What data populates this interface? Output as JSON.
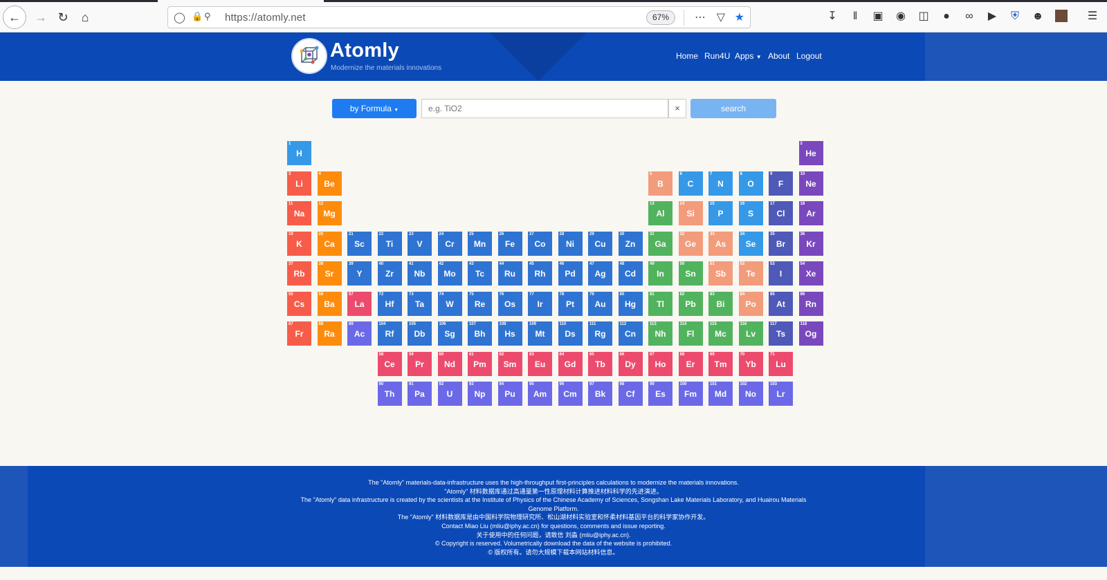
{
  "browser": {
    "url": "https://atomly.net",
    "zoom": "67%",
    "icons": [
      "back-icon",
      "forward-icon",
      "reload-icon",
      "home-icon",
      "shield-icon",
      "lock-icon",
      "key-icon",
      "more-icon",
      "pocket-icon",
      "star-icon",
      "download-icon",
      "library-icon",
      "containers-icon",
      "circle-icon",
      "sidebar-icon",
      "extension-icon",
      "link-icon",
      "arrow-icon",
      "ublock-icon",
      "account-icon",
      "avatar-icon",
      "menu-icon"
    ]
  },
  "header": {
    "title": "Atomly",
    "subtitle": "Modernize the materials innovations",
    "menu": [
      "Home",
      "Run4U",
      "Apps",
      "About",
      "Logout"
    ]
  },
  "search": {
    "mode_label": "by Formula",
    "placeholder": "e.g. TiO2",
    "clear_label": "×",
    "button_label": "search"
  },
  "colors": {
    "alkali": "#f75c4a",
    "alkaline": "#fd8c0d",
    "transition": "#2f74d2",
    "lanthanide": "#ec4b6e",
    "actinide": "#6b69e8",
    "post_transition": "#52b35f",
    "metalloid": "#f29c7c",
    "nonmetal": "#3699e8",
    "halogen": "#4e59b8",
    "noble": "#7a48bd"
  },
  "elements": [
    {
      "n": "1",
      "s": "H",
      "r": 1,
      "c": 1,
      "t": "nonmetal"
    },
    {
      "n": "2",
      "s": "He",
      "r": 1,
      "c": 18,
      "t": "noble"
    },
    {
      "n": "3",
      "s": "Li",
      "r": 2,
      "c": 1,
      "t": "alkali"
    },
    {
      "n": "4",
      "s": "Be",
      "r": 2,
      "c": 2,
      "t": "alkaline"
    },
    {
      "n": "5",
      "s": "B",
      "r": 2,
      "c": 13,
      "t": "metalloid"
    },
    {
      "n": "6",
      "s": "C",
      "r": 2,
      "c": 14,
      "t": "nonmetal"
    },
    {
      "n": "7",
      "s": "N",
      "r": 2,
      "c": 15,
      "t": "nonmetal"
    },
    {
      "n": "8",
      "s": "O",
      "r": 2,
      "c": 16,
      "t": "nonmetal"
    },
    {
      "n": "9",
      "s": "F",
      "r": 2,
      "c": 17,
      "t": "halogen"
    },
    {
      "n": "10",
      "s": "Ne",
      "r": 2,
      "c": 18,
      "t": "noble"
    },
    {
      "n": "11",
      "s": "Na",
      "r": 3,
      "c": 1,
      "t": "alkali"
    },
    {
      "n": "12",
      "s": "Mg",
      "r": 3,
      "c": 2,
      "t": "alkaline"
    },
    {
      "n": "13",
      "s": "Al",
      "r": 3,
      "c": 13,
      "t": "post_transition"
    },
    {
      "n": "14",
      "s": "Si",
      "r": 3,
      "c": 14,
      "t": "metalloid"
    },
    {
      "n": "15",
      "s": "P",
      "r": 3,
      "c": 15,
      "t": "nonmetal"
    },
    {
      "n": "16",
      "s": "S",
      "r": 3,
      "c": 16,
      "t": "nonmetal"
    },
    {
      "n": "17",
      "s": "Cl",
      "r": 3,
      "c": 17,
      "t": "halogen"
    },
    {
      "n": "18",
      "s": "Ar",
      "r": 3,
      "c": 18,
      "t": "noble"
    },
    {
      "n": "19",
      "s": "K",
      "r": 4,
      "c": 1,
      "t": "alkali"
    },
    {
      "n": "20",
      "s": "Ca",
      "r": 4,
      "c": 2,
      "t": "alkaline"
    },
    {
      "n": "21",
      "s": "Sc",
      "r": 4,
      "c": 3,
      "t": "transition"
    },
    {
      "n": "22",
      "s": "Ti",
      "r": 4,
      "c": 4,
      "t": "transition"
    },
    {
      "n": "23",
      "s": "V",
      "r": 4,
      "c": 5,
      "t": "transition"
    },
    {
      "n": "24",
      "s": "Cr",
      "r": 4,
      "c": 6,
      "t": "transition"
    },
    {
      "n": "25",
      "s": "Mn",
      "r": 4,
      "c": 7,
      "t": "transition"
    },
    {
      "n": "26",
      "s": "Fe",
      "r": 4,
      "c": 8,
      "t": "transition"
    },
    {
      "n": "27",
      "s": "Co",
      "r": 4,
      "c": 9,
      "t": "transition"
    },
    {
      "n": "28",
      "s": "Ni",
      "r": 4,
      "c": 10,
      "t": "transition"
    },
    {
      "n": "29",
      "s": "Cu",
      "r": 4,
      "c": 11,
      "t": "transition"
    },
    {
      "n": "30",
      "s": "Zn",
      "r": 4,
      "c": 12,
      "t": "transition"
    },
    {
      "n": "31",
      "s": "Ga",
      "r": 4,
      "c": 13,
      "t": "post_transition"
    },
    {
      "n": "32",
      "s": "Ge",
      "r": 4,
      "c": 14,
      "t": "metalloid"
    },
    {
      "n": "33",
      "s": "As",
      "r": 4,
      "c": 15,
      "t": "metalloid"
    },
    {
      "n": "34",
      "s": "Se",
      "r": 4,
      "c": 16,
      "t": "nonmetal"
    },
    {
      "n": "35",
      "s": "Br",
      "r": 4,
      "c": 17,
      "t": "halogen"
    },
    {
      "n": "36",
      "s": "Kr",
      "r": 4,
      "c": 18,
      "t": "noble"
    },
    {
      "n": "37",
      "s": "Rb",
      "r": 5,
      "c": 1,
      "t": "alkali"
    },
    {
      "n": "38",
      "s": "Sr",
      "r": 5,
      "c": 2,
      "t": "alkaline"
    },
    {
      "n": "39",
      "s": "Y",
      "r": 5,
      "c": 3,
      "t": "transition"
    },
    {
      "n": "40",
      "s": "Zr",
      "r": 5,
      "c": 4,
      "t": "transition"
    },
    {
      "n": "41",
      "s": "Nb",
      "r": 5,
      "c": 5,
      "t": "transition"
    },
    {
      "n": "42",
      "s": "Mo",
      "r": 5,
      "c": 6,
      "t": "transition"
    },
    {
      "n": "43",
      "s": "Tc",
      "r": 5,
      "c": 7,
      "t": "transition"
    },
    {
      "n": "44",
      "s": "Ru",
      "r": 5,
      "c": 8,
      "t": "transition"
    },
    {
      "n": "45",
      "s": "Rh",
      "r": 5,
      "c": 9,
      "t": "transition"
    },
    {
      "n": "46",
      "s": "Pd",
      "r": 5,
      "c": 10,
      "t": "transition"
    },
    {
      "n": "47",
      "s": "Ag",
      "r": 5,
      "c": 11,
      "t": "transition"
    },
    {
      "n": "48",
      "s": "Cd",
      "r": 5,
      "c": 12,
      "t": "transition"
    },
    {
      "n": "49",
      "s": "In",
      "r": 5,
      "c": 13,
      "t": "post_transition"
    },
    {
      "n": "50",
      "s": "Sn",
      "r": 5,
      "c": 14,
      "t": "post_transition"
    },
    {
      "n": "51",
      "s": "Sb",
      "r": 5,
      "c": 15,
      "t": "metalloid"
    },
    {
      "n": "52",
      "s": "Te",
      "r": 5,
      "c": 16,
      "t": "metalloid"
    },
    {
      "n": "53",
      "s": "I",
      "r": 5,
      "c": 17,
      "t": "halogen"
    },
    {
      "n": "54",
      "s": "Xe",
      "r": 5,
      "c": 18,
      "t": "noble"
    },
    {
      "n": "55",
      "s": "Cs",
      "r": 6,
      "c": 1,
      "t": "alkali"
    },
    {
      "n": "56",
      "s": "Ba",
      "r": 6,
      "c": 2,
      "t": "alkaline"
    },
    {
      "n": "57",
      "s": "La",
      "r": 6,
      "c": 3,
      "t": "lanthanide"
    },
    {
      "n": "72",
      "s": "Hf",
      "r": 6,
      "c": 4,
      "t": "transition"
    },
    {
      "n": "73",
      "s": "Ta",
      "r": 6,
      "c": 5,
      "t": "transition"
    },
    {
      "n": "74",
      "s": "W",
      "r": 6,
      "c": 6,
      "t": "transition"
    },
    {
      "n": "75",
      "s": "Re",
      "r": 6,
      "c": 7,
      "t": "transition"
    },
    {
      "n": "76",
      "s": "Os",
      "r": 6,
      "c": 8,
      "t": "transition"
    },
    {
      "n": "77",
      "s": "Ir",
      "r": 6,
      "c": 9,
      "t": "transition"
    },
    {
      "n": "78",
      "s": "Pt",
      "r": 6,
      "c": 10,
      "t": "transition"
    },
    {
      "n": "79",
      "s": "Au",
      "r": 6,
      "c": 11,
      "t": "transition"
    },
    {
      "n": "80",
      "s": "Hg",
      "r": 6,
      "c": 12,
      "t": "transition"
    },
    {
      "n": "81",
      "s": "Tl",
      "r": 6,
      "c": 13,
      "t": "post_transition"
    },
    {
      "n": "82",
      "s": "Pb",
      "r": 6,
      "c": 14,
      "t": "post_transition"
    },
    {
      "n": "83",
      "s": "Bi",
      "r": 6,
      "c": 15,
      "t": "post_transition"
    },
    {
      "n": "84",
      "s": "Po",
      "r": 6,
      "c": 16,
      "t": "metalloid"
    },
    {
      "n": "85",
      "s": "At",
      "r": 6,
      "c": 17,
      "t": "halogen"
    },
    {
      "n": "86",
      "s": "Rn",
      "r": 6,
      "c": 18,
      "t": "noble"
    },
    {
      "n": "87",
      "s": "Fr",
      "r": 7,
      "c": 1,
      "t": "alkali"
    },
    {
      "n": "88",
      "s": "Ra",
      "r": 7,
      "c": 2,
      "t": "alkaline"
    },
    {
      "n": "89",
      "s": "Ac",
      "r": 7,
      "c": 3,
      "t": "actinide"
    },
    {
      "n": "104",
      "s": "Rf",
      "r": 7,
      "c": 4,
      "t": "transition"
    },
    {
      "n": "105",
      "s": "Db",
      "r": 7,
      "c": 5,
      "t": "transition"
    },
    {
      "n": "106",
      "s": "Sg",
      "r": 7,
      "c": 6,
      "t": "transition"
    },
    {
      "n": "107",
      "s": "Bh",
      "r": 7,
      "c": 7,
      "t": "transition"
    },
    {
      "n": "108",
      "s": "Hs",
      "r": 7,
      "c": 8,
      "t": "transition"
    },
    {
      "n": "109",
      "s": "Mt",
      "r": 7,
      "c": 9,
      "t": "transition"
    },
    {
      "n": "110",
      "s": "Ds",
      "r": 7,
      "c": 10,
      "t": "transition"
    },
    {
      "n": "111",
      "s": "Rg",
      "r": 7,
      "c": 11,
      "t": "transition"
    },
    {
      "n": "112",
      "s": "Cn",
      "r": 7,
      "c": 12,
      "t": "transition"
    },
    {
      "n": "113",
      "s": "Nh",
      "r": 7,
      "c": 13,
      "t": "post_transition"
    },
    {
      "n": "114",
      "s": "Fl",
      "r": 7,
      "c": 14,
      "t": "post_transition"
    },
    {
      "n": "115",
      "s": "Mc",
      "r": 7,
      "c": 15,
      "t": "post_transition"
    },
    {
      "n": "116",
      "s": "Lv",
      "r": 7,
      "c": 16,
      "t": "post_transition"
    },
    {
      "n": "117",
      "s": "Ts",
      "r": 7,
      "c": 17,
      "t": "halogen"
    },
    {
      "n": "118",
      "s": "Og",
      "r": 7,
      "c": 18,
      "t": "noble"
    },
    {
      "n": "58",
      "s": "Ce",
      "r": 8,
      "c": 4,
      "t": "lanthanide"
    },
    {
      "n": "59",
      "s": "Pr",
      "r": 8,
      "c": 5,
      "t": "lanthanide"
    },
    {
      "n": "60",
      "s": "Nd",
      "r": 8,
      "c": 6,
      "t": "lanthanide"
    },
    {
      "n": "61",
      "s": "Pm",
      "r": 8,
      "c": 7,
      "t": "lanthanide"
    },
    {
      "n": "62",
      "s": "Sm",
      "r": 8,
      "c": 8,
      "t": "lanthanide"
    },
    {
      "n": "63",
      "s": "Eu",
      "r": 8,
      "c": 9,
      "t": "lanthanide"
    },
    {
      "n": "64",
      "s": "Gd",
      "r": 8,
      "c": 10,
      "t": "lanthanide"
    },
    {
      "n": "65",
      "s": "Tb",
      "r": 8,
      "c": 11,
      "t": "lanthanide"
    },
    {
      "n": "66",
      "s": "Dy",
      "r": 8,
      "c": 12,
      "t": "lanthanide"
    },
    {
      "n": "67",
      "s": "Ho",
      "r": 8,
      "c": 13,
      "t": "lanthanide"
    },
    {
      "n": "68",
      "s": "Er",
      "r": 8,
      "c": 14,
      "t": "lanthanide"
    },
    {
      "n": "69",
      "s": "Tm",
      "r": 8,
      "c": 15,
      "t": "lanthanide"
    },
    {
      "n": "70",
      "s": "Yb",
      "r": 8,
      "c": 16,
      "t": "lanthanide"
    },
    {
      "n": "71",
      "s": "Lu",
      "r": 8,
      "c": 17,
      "t": "lanthanide"
    },
    {
      "n": "90",
      "s": "Th",
      "r": 9,
      "c": 4,
      "t": "actinide"
    },
    {
      "n": "91",
      "s": "Pa",
      "r": 9,
      "c": 5,
      "t": "actinide"
    },
    {
      "n": "92",
      "s": "U",
      "r": 9,
      "c": 6,
      "t": "actinide"
    },
    {
      "n": "93",
      "s": "Np",
      "r": 9,
      "c": 7,
      "t": "actinide"
    },
    {
      "n": "94",
      "s": "Pu",
      "r": 9,
      "c": 8,
      "t": "actinide"
    },
    {
      "n": "95",
      "s": "Am",
      "r": 9,
      "c": 9,
      "t": "actinide"
    },
    {
      "n": "96",
      "s": "Cm",
      "r": 9,
      "c": 10,
      "t": "actinide"
    },
    {
      "n": "97",
      "s": "Bk",
      "r": 9,
      "c": 11,
      "t": "actinide"
    },
    {
      "n": "98",
      "s": "Cf",
      "r": 9,
      "c": 12,
      "t": "actinide"
    },
    {
      "n": "99",
      "s": "Es",
      "r": 9,
      "c": 13,
      "t": "actinide"
    },
    {
      "n": "100",
      "s": "Fm",
      "r": 9,
      "c": 14,
      "t": "actinide"
    },
    {
      "n": "101",
      "s": "Md",
      "r": 9,
      "c": 15,
      "t": "actinide"
    },
    {
      "n": "102",
      "s": "No",
      "r": 9,
      "c": 16,
      "t": "actinide"
    },
    {
      "n": "103",
      "s": "Lr",
      "r": 9,
      "c": 17,
      "t": "actinide"
    }
  ],
  "footer": {
    "lines": [
      "The \"Atomly\" materials-data-infrastructure uses the high-throughput first-principles calculations to modernize the materials innovations.",
      "\"Atomly\" 材料数据库通过高通量第一性原理材料计算推进材料科学的先进演进。",
      "The \"Atomly\" data infrastructure is created by the scientists at the Institute of Physics of the Chinese Academy of Sciences, Songshan Lake Materials Laboratory, and Huairou Materials",
      "Genome Platform.",
      "The \"Atomly\" 材料数据库是由中国科学院物理研究所、松山湖材料实验室和怀柔材料基因平台的科学家协作开发。",
      "Contact Miao Liu (mliu@iphy.ac.cn) for questions, comments and issue reporting.",
      "关于使用中的任何问题，请致信 刘淼 (mliu@iphy.ac.cn).",
      "© Copyright is reserved. Volumetrically download the data of the website is prohibited.",
      "© 版权所有。请勿大规模下载本网站材料信息。"
    ]
  }
}
